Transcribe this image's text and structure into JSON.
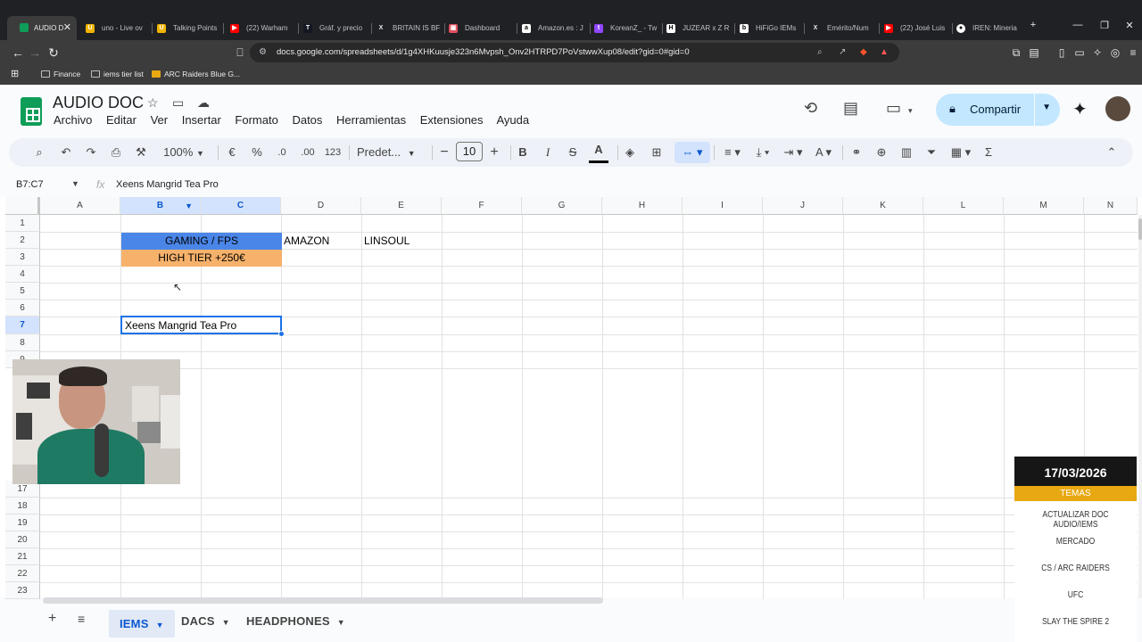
{
  "browser": {
    "tabs": [
      {
        "label": "AUDIO D",
        "icon": "google-sheets-icon",
        "color": "#0f9d58",
        "active": true
      },
      {
        "label": "uno - Live ov",
        "icon": "u-icon",
        "color": "#f0b400"
      },
      {
        "label": "Talking Points",
        "icon": "u-icon",
        "color": "#f0b400"
      },
      {
        "label": "(22) Warham",
        "icon": "youtube-icon",
        "color": "#ff0000"
      },
      {
        "label": "Gráf. y precio",
        "icon": "tradingview-icon",
        "color": "#131722"
      },
      {
        "label": "BRITAIN IS BF",
        "icon": "x-icon",
        "color": "#000000"
      },
      {
        "label": "Dashboard",
        "icon": "dashboard-icon",
        "color": "#e04f5f"
      },
      {
        "label": "Amazon.es : J",
        "icon": "amazon-icon",
        "color": "#ffffff"
      },
      {
        "label": "KoreanZ_ - Tw",
        "icon": "twitch-icon",
        "color": "#9146ff"
      },
      {
        "label": "JUZEAR x Z R",
        "icon": "hifigo-icon",
        "color": "#ffffff"
      },
      {
        "label": "HiFiGo IEMs",
        "icon": "b-icon",
        "color": "#ffffff"
      },
      {
        "label": "Emérito/Num",
        "icon": "x-icon",
        "color": "#000000"
      },
      {
        "label": "(22) José Luis",
        "icon": "youtube-icon",
        "color": "#ff0000"
      },
      {
        "label": "IREN: Mineria",
        "icon": "github-icon",
        "color": "#ffffff"
      }
    ],
    "url": "docs.google.com/spreadsheets/d/1g4XHKuusje323n6Mvpsh_Onv2HTRPD7PoVstwwXup08/edit?gid=0#gid=0",
    "bookmarks": [
      "Finance",
      "iems tier list",
      "ARC Raiders Blue G..."
    ]
  },
  "doc": {
    "title": "AUDIO DOC",
    "menus": [
      "Archivo",
      "Editar",
      "Ver",
      "Insertar",
      "Formato",
      "Datos",
      "Herramientas",
      "Extensiones",
      "Ayuda"
    ],
    "share_label": "Compartir"
  },
  "toolbar": {
    "zoom": "100%",
    "currency": "€",
    "percent": "%",
    "dec_less": ".0",
    "dec_more": ".00",
    "number_format": "123",
    "font": "Predet...",
    "font_size": "10"
  },
  "formula_bar": {
    "cell_ref": "B7:C7",
    "fx": "fx",
    "value": "Xeens Mangrid Tea Pro"
  },
  "grid": {
    "columns": [
      "A",
      "B",
      "C",
      "D",
      "E",
      "F",
      "G",
      "H",
      "I",
      "J",
      "K",
      "L",
      "M",
      "N"
    ],
    "rows": [
      "1",
      "2",
      "3",
      "4",
      "5",
      "6",
      "7",
      "8",
      "9",
      "17",
      "18",
      "19",
      "20",
      "21",
      "22",
      "23"
    ],
    "cells": {
      "b2": {
        "text": "GAMING / FPS",
        "bg": "#4a86e8"
      },
      "b3": {
        "text": "HIGH TIER +250€",
        "bg": "#f6b26b"
      },
      "d2": "AMAZON",
      "e2": "LINSOUL",
      "b7": "Xeens Mangrid Tea Pro"
    }
  },
  "sheets": [
    "IEMS",
    "DACS",
    "HEADPHONES"
  ],
  "overlay": {
    "date": "17/03/2026",
    "heading": "TEMAS",
    "items": [
      "ACTUALIZAR DOC AUDIO/IEMS",
      "MERCADO",
      "CS / ARC RAIDERS",
      "UFC",
      "SLAY THE SPIRE 2"
    ],
    "accent": "#e8a812"
  }
}
